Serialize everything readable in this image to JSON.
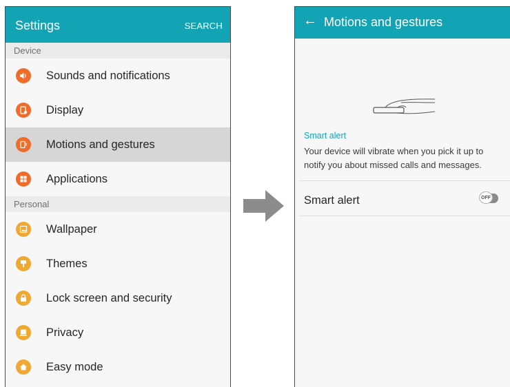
{
  "left": {
    "title": "Settings",
    "search_label": "SEARCH",
    "sections": [
      {
        "header": "Device",
        "items": [
          {
            "label": "Sounds and notifications",
            "icon": "speaker-icon",
            "color": "#ef6c2b"
          },
          {
            "label": "Display",
            "icon": "display-icon",
            "color": "#ef6c2b"
          },
          {
            "label": "Motions and gestures",
            "icon": "motion-icon",
            "color": "#ef6c2b",
            "selected": true
          },
          {
            "label": "Applications",
            "icon": "apps-grid-icon",
            "color": "#ef6c2b"
          }
        ]
      },
      {
        "header": "Personal",
        "items": [
          {
            "label": "Wallpaper",
            "icon": "wallpaper-icon",
            "color": "#f0a832"
          },
          {
            "label": "Themes",
            "icon": "brush-icon",
            "color": "#f0a832"
          },
          {
            "label": "Lock screen and security",
            "icon": "lock-icon",
            "color": "#f0a832"
          },
          {
            "label": "Privacy",
            "icon": "privacy-icon",
            "color": "#f0a832"
          },
          {
            "label": "Easy mode",
            "icon": "home-icon",
            "color": "#f0a832"
          }
        ]
      }
    ]
  },
  "right": {
    "back_icon": "back-arrow-icon",
    "title": "Motions and gestures",
    "illustration": "phone-hand-icon",
    "smart_alert_header": "Smart alert",
    "smart_alert_desc": "Your device will vibrate when you pick it up to notify you about missed calls and messages.",
    "smart_alert_label": "Smart alert",
    "toggle_text": "OFF",
    "toggle_state": "off"
  },
  "colors": {
    "appbar": "#12a3b4",
    "accent_text": "#17a2b8",
    "device_icons": "#ef6c2b",
    "personal_icons": "#f0a832",
    "arrow": "#8c8c8c"
  }
}
